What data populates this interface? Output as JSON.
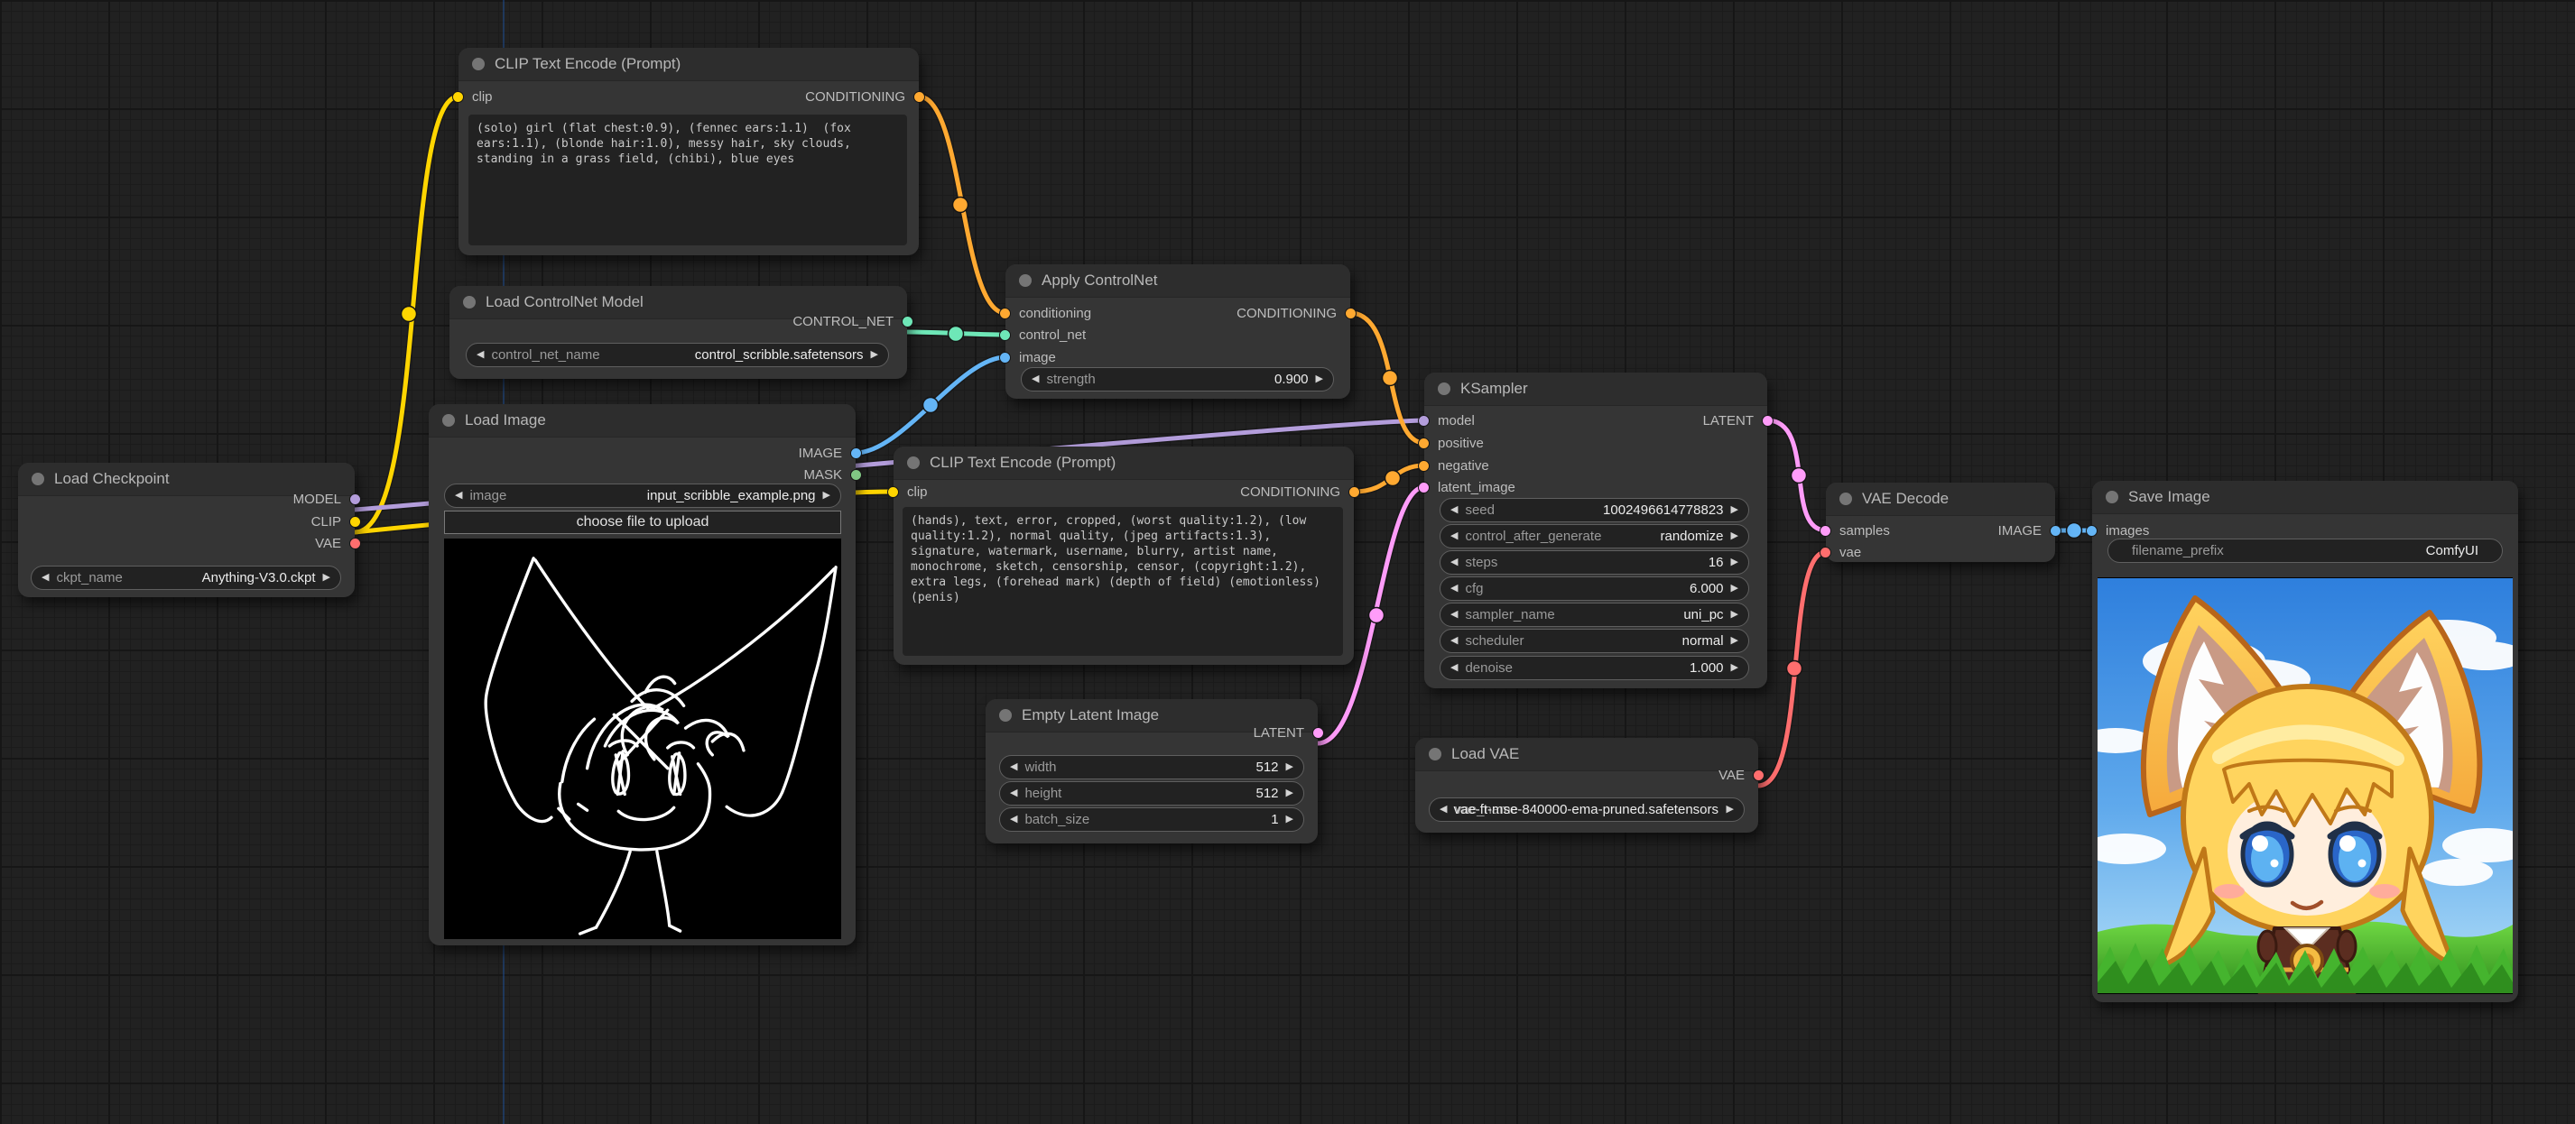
{
  "colors": {
    "canvas_bg": "#212121",
    "node_bg": "#353535",
    "node_title_bg": "#2d2d2d",
    "model": "#B39DDB",
    "clip": "#FFD500",
    "vae": "#FF6E6E",
    "conditioning": "#FFA931",
    "control_net": "#6EE7B7",
    "image": "#64B5F6",
    "mask": "#81C784",
    "latent": "#FF9CF9"
  },
  "nodes": {
    "clip_text_encode_positive": {
      "title": "CLIP Text Encode (Prompt)",
      "inputs": [
        "clip"
      ],
      "outputs": [
        "CONDITIONING"
      ],
      "text": "(solo) girl (flat chest:0.9), (fennec ears:1.1)  (fox ears:1.1), (blonde hair:1.0), messy hair, sky clouds, standing in a grass field, (chibi), blue eyes"
    },
    "load_controlnet": {
      "title": "Load ControlNet Model",
      "outputs": [
        "CONTROL_NET"
      ],
      "widgets": [
        {
          "label": "control_net_name",
          "value": "control_scribble.safetensors"
        }
      ]
    },
    "load_checkpoint": {
      "title": "Load Checkpoint",
      "outputs": [
        "MODEL",
        "CLIP",
        "VAE"
      ],
      "widgets": [
        {
          "label": "ckpt_name",
          "value": "Anything-V3.0.ckpt"
        }
      ]
    },
    "load_image": {
      "title": "Load Image",
      "outputs": [
        "IMAGE",
        "MASK"
      ],
      "widgets": [
        {
          "label": "image",
          "value": "input_scribble_example.png"
        }
      ],
      "button": "choose file to upload"
    },
    "apply_controlnet": {
      "title": "Apply ControlNet",
      "inputs": [
        "conditioning",
        "control_net",
        "image"
      ],
      "outputs": [
        "CONDITIONING"
      ],
      "widgets": [
        {
          "label": "strength",
          "value": "0.900"
        }
      ]
    },
    "clip_text_encode_negative": {
      "title": "CLIP Text Encode (Prompt)",
      "inputs": [
        "clip"
      ],
      "outputs": [
        "CONDITIONING"
      ],
      "text": "(hands), text, error, cropped, (worst quality:1.2), (low quality:1.2), normal quality, (jpeg artifacts:1.3), signature, watermark, username, blurry, artist name, monochrome, sketch, censorship, censor, (copyright:1.2), extra legs, (forehead mark) (depth of field) (emotionless) (penis)"
    },
    "empty_latent": {
      "title": "Empty Latent Image",
      "outputs": [
        "LATENT"
      ],
      "widgets": [
        {
          "label": "width",
          "value": "512"
        },
        {
          "label": "height",
          "value": "512"
        },
        {
          "label": "batch_size",
          "value": "1"
        }
      ]
    },
    "ksampler": {
      "title": "KSampler",
      "inputs": [
        "model",
        "positive",
        "negative",
        "latent_image"
      ],
      "outputs": [
        "LATENT"
      ],
      "widgets": [
        {
          "label": "seed",
          "value": "1002496614778823"
        },
        {
          "label": "control_after_generate",
          "value": "randomize"
        },
        {
          "label": "steps",
          "value": "16"
        },
        {
          "label": "cfg",
          "value": "6.000"
        },
        {
          "label": "sampler_name",
          "value": "uni_pc"
        },
        {
          "label": "scheduler",
          "value": "normal"
        },
        {
          "label": "denoise",
          "value": "1.000"
        }
      ]
    },
    "load_vae": {
      "title": "Load VAE",
      "outputs": [
        "VAE"
      ],
      "widgets": [
        {
          "label": "vae_name",
          "value": "vae-ft-mse-840000-ema-pruned.safetensors"
        }
      ]
    },
    "vae_decode": {
      "title": "VAE Decode",
      "inputs": [
        "samples",
        "vae"
      ],
      "outputs": [
        "IMAGE"
      ]
    },
    "save_image": {
      "title": "Save Image",
      "inputs": [
        "images"
      ],
      "widgets": [
        {
          "label": "filename_prefix",
          "value": "ComfyUI"
        }
      ]
    }
  }
}
